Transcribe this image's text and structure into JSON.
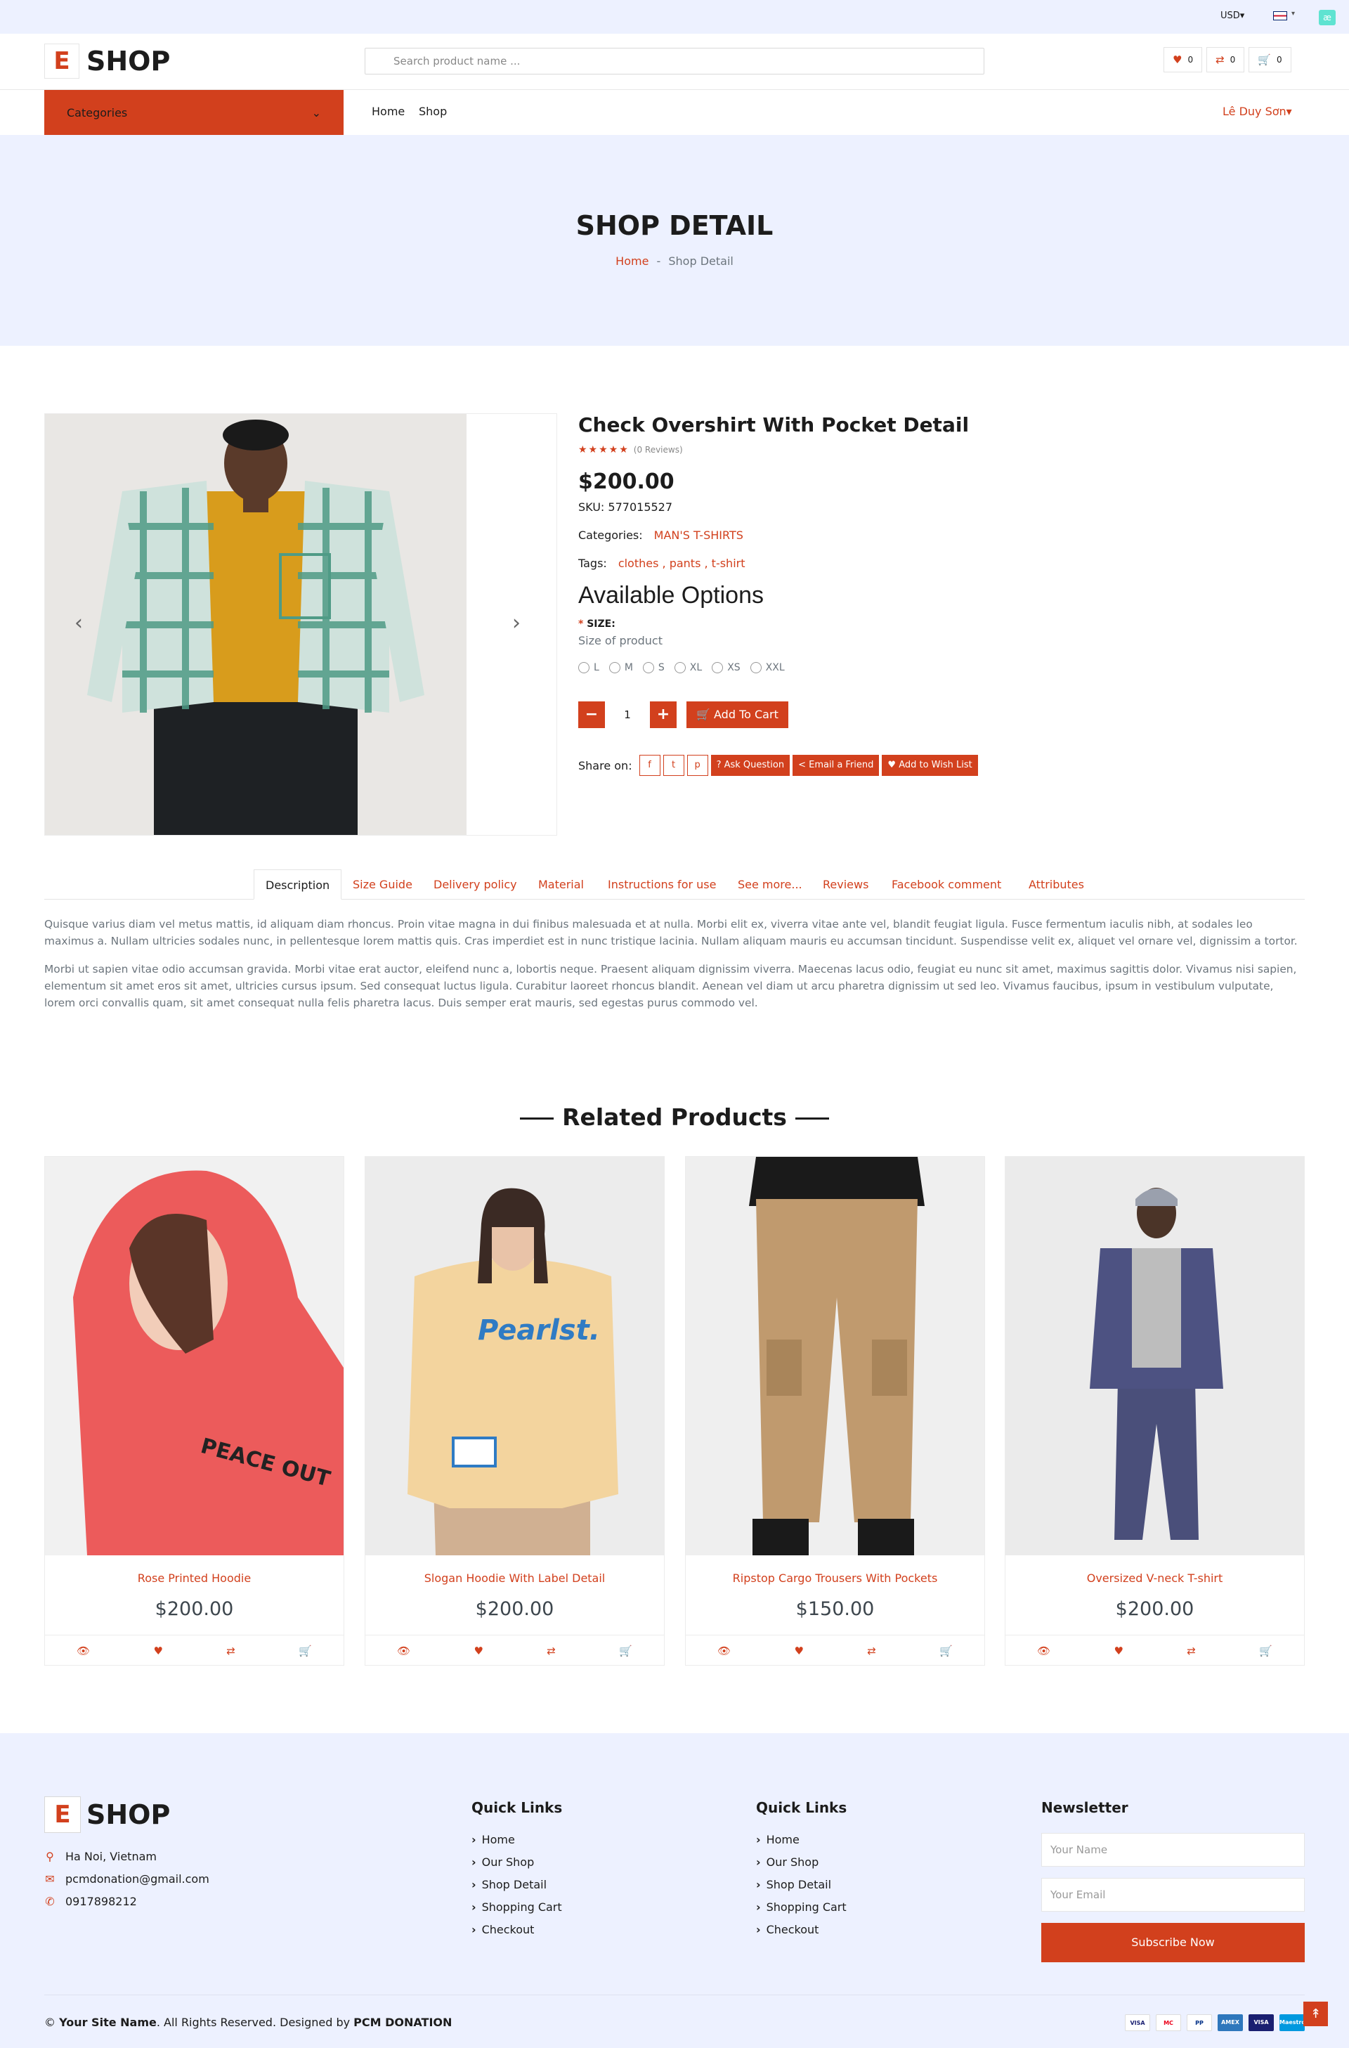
{
  "topbar": {
    "currency": "USD",
    "currency_caret": "▾",
    "lang_caret": "▾",
    "ext_icon": "æ"
  },
  "header": {
    "logo_letter": "E",
    "logo_text": "SHOP",
    "search_placeholder": "Search product name ...",
    "wishlist_count": "0",
    "compare_count": "0",
    "cart_count": "0"
  },
  "nav": {
    "categories_label": "Categories",
    "categories_caret": "⌄",
    "home": "Home",
    "shop": "Shop",
    "user": "Lê Duy Sơn",
    "user_caret": "▾"
  },
  "banner": {
    "title": "SHOP DETAIL",
    "bc_home": "Home",
    "bc_sep": "-",
    "bc_current": "Shop Detail"
  },
  "gallery": {
    "prev": "‹",
    "next": "›"
  },
  "product": {
    "title": "Check Overshirt With Pocket Detail",
    "stars": "★★★★★",
    "reviews": "(0 Reviews)",
    "rating": 0,
    "price": "$200.00",
    "sku_label": "SKU:",
    "sku": "577015527",
    "categories_label": "Categories:",
    "categories": "MAN'S T-SHIRTS",
    "tags_label": "Tags:",
    "tags": "clothes , pants , t-shirt",
    "options_title": "Available Options",
    "size_star": "*",
    "size_label": "SIZE:",
    "size_hint": "Size of product",
    "sizes": [
      "L",
      "M",
      "S",
      "XL",
      "XS",
      "XXL"
    ],
    "qty_minus": "−",
    "qty": "1",
    "qty_plus": "+",
    "add_to_cart": "Add To Cart",
    "share_label": "Share on:",
    "share_icons": [
      "f",
      "t",
      "p"
    ],
    "ask_question": "? Ask Question",
    "email_friend": "< Email a Friend",
    "wish_list": "♥ Add to Wish List"
  },
  "tabs": [
    "Description",
    "Size Guide",
    "Delivery policy",
    "Material",
    "Instructions for use",
    "See more...",
    "Reviews",
    "Facebook comment",
    "Attributes"
  ],
  "description": [
    "Quisque varius diam vel metus mattis, id aliquam diam rhoncus. Proin vitae magna in dui finibus malesuada et at nulla. Morbi elit ex, viverra vitae ante vel, blandit feugiat ligula. Fusce fermentum iaculis nibh, at sodales leo maximus a. Nullam ultricies sodales nunc, in pellentesque lorem mattis quis. Cras imperdiet est in nunc tristique lacinia. Nullam aliquam mauris eu accumsan tincidunt. Suspendisse velit ex, aliquet vel ornare vel, dignissim a tortor.",
    "Morbi ut sapien vitae odio accumsan gravida. Morbi vitae erat auctor, eleifend nunc a, lobortis neque. Praesent aliquam dignissim viverra. Maecenas lacus odio, feugiat eu nunc sit amet, maximus sagittis dolor. Vivamus nisi sapien, elementum sit amet eros sit amet, ultricies cursus ipsum. Sed consequat luctus ligula. Curabitur laoreet rhoncus blandit. Aenean vel diam ut arcu pharetra dignissim ut sed leo. Vivamus faucibus, ipsum in vestibulum vulputate, lorem orci convallis quam, sit amet consequat nulla felis pharetra lacus. Duis semper erat mauris, sed egestas purus commodo vel."
  ],
  "related": {
    "title": "Related Products",
    "items": [
      {
        "name": "Rose Printed Hoodie",
        "price": "$200.00",
        "img_text": "PEACE OUT"
      },
      {
        "name": "Slogan Hoodie With Label Detail",
        "price": "$200.00",
        "img_text": "Pearlst."
      },
      {
        "name": "Ripstop Cargo Trousers With Pockets",
        "price": "$150.00"
      },
      {
        "name": "Oversized V-neck T-shirt",
        "price": "$200.00"
      }
    ]
  },
  "footer": {
    "logo_letter": "E",
    "logo_text": "SHOP",
    "address": "Ha Noi, Vietnam",
    "email": "pcmdonation@gmail.com",
    "phone": "0917898212",
    "col1_title": "Quick Links",
    "col2_title": "Quick Links",
    "links": [
      "Home",
      "Our Shop",
      "Shop Detail",
      "Shopping Cart",
      "Checkout"
    ],
    "link_chevron": "›",
    "newsletter_title": "Newsletter",
    "name_placeholder": "Your Name",
    "email_placeholder": "Your Email",
    "subscribe": "Subscribe Now",
    "copy_symbol": "©",
    "site_name": "Your Site Name",
    "rights": ". All Rights Reserved. Designed by ",
    "designer": "PCM DONATION",
    "payments": [
      "VISA",
      "MC",
      "PP",
      "AMEX",
      "VISA",
      "Maestro"
    ]
  },
  "colors": {
    "accent": "#d2401d",
    "bg_light": "#edf1ff",
    "text_dark": "#1c1c1c"
  },
  "icons": {
    "top": "↟"
  }
}
